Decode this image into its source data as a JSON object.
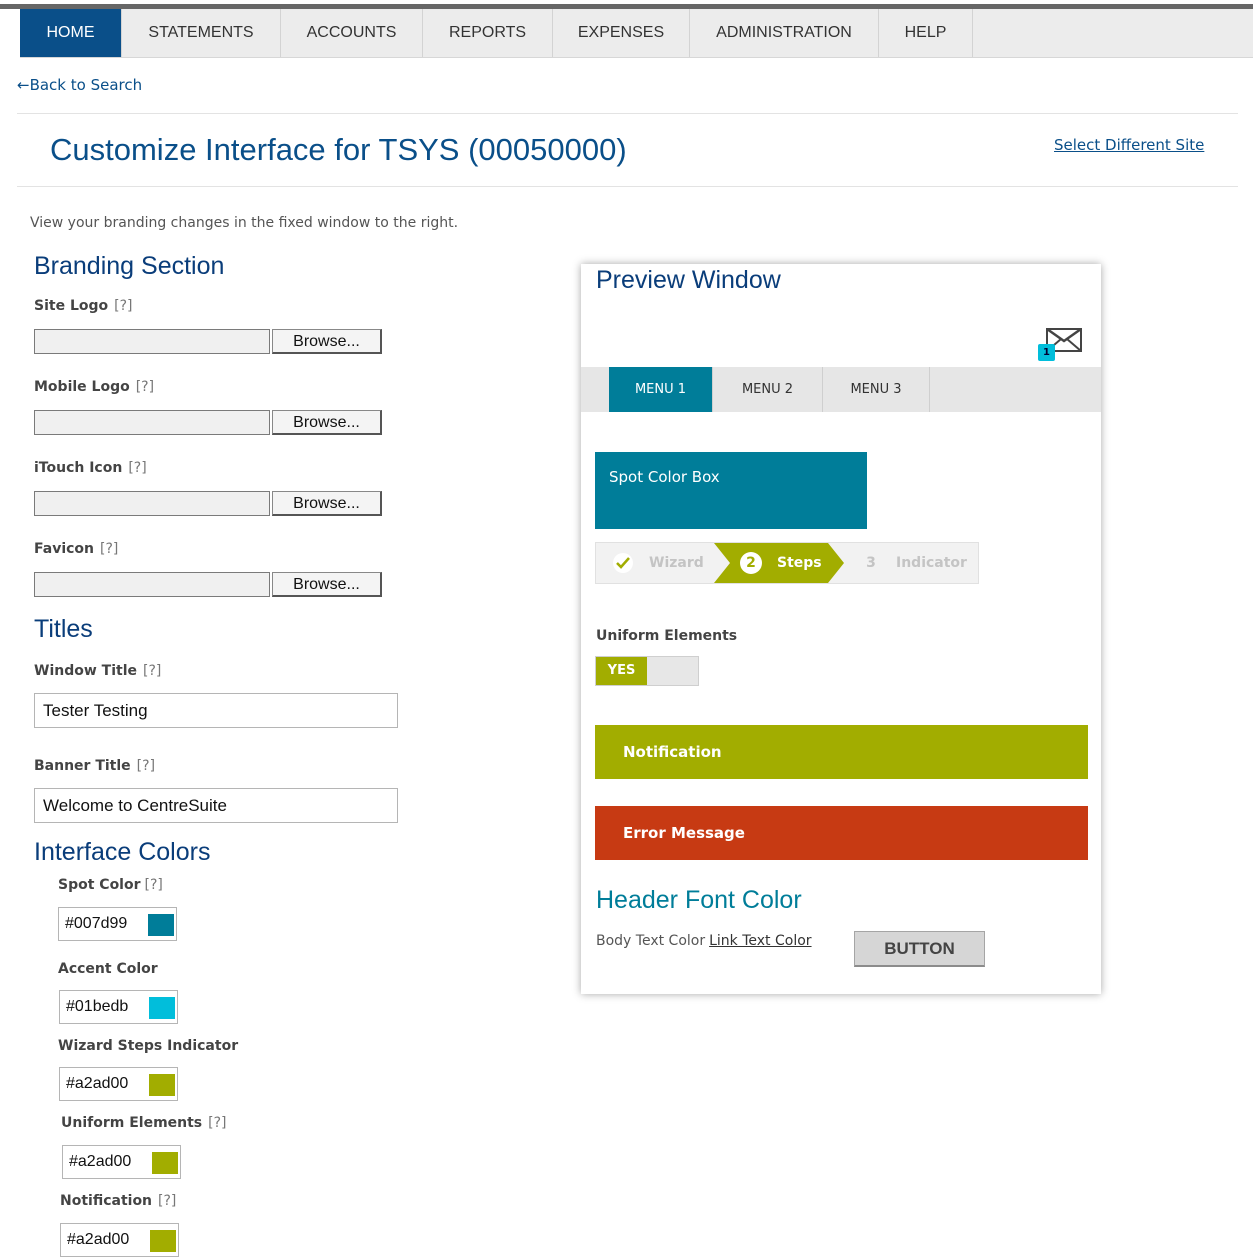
{
  "nav": {
    "tabs": [
      {
        "label": "HOME"
      },
      {
        "label": "STATEMENTS"
      },
      {
        "label": "ACCOUNTS"
      },
      {
        "label": "REPORTS"
      },
      {
        "label": "EXPENSES"
      },
      {
        "label": "ADMINISTRATION"
      },
      {
        "label": "HELP"
      }
    ],
    "active": "HOME"
  },
  "back_link": "←Back to Search",
  "page": {
    "title": "Customize Interface for TSYS (00050000)",
    "select_site": "Select Different Site",
    "intro": "View your branding changes in the fixed window to the right."
  },
  "help_marker": "[?]",
  "branding": {
    "heading": "Branding Section",
    "browse_label": "Browse...",
    "fields": [
      {
        "label": "Site Logo"
      },
      {
        "label": "Mobile Logo"
      },
      {
        "label": "iTouch Icon"
      },
      {
        "label": "Favicon"
      }
    ]
  },
  "titles": {
    "heading": "Titles",
    "window_title": {
      "label": "Window Title",
      "value": "Tester Testing"
    },
    "banner_title": {
      "label": "Banner Title",
      "value": "Welcome to CentreSuite"
    }
  },
  "colors": {
    "heading": "Interface Colors",
    "spot": {
      "label": "Spot Color",
      "value": "#007d99"
    },
    "accent": {
      "label": "Accent Color",
      "value": "#01bedb"
    },
    "wizard": {
      "label": "Wizard Steps Indicator",
      "value": "#a2ad00"
    },
    "uniform": {
      "label": "Uniform Elements",
      "value": "#a2ad00"
    },
    "notification": {
      "label": "Notification",
      "value": "#a2ad00"
    }
  },
  "preview": {
    "title": "Preview Window",
    "mail_icon": "envelope-icon",
    "mail_badge": "1",
    "menu": [
      "MENU 1",
      "MENU 2",
      "MENU 3"
    ],
    "spot_box": "Spot Color Box",
    "wizard": {
      "step1": {
        "label": "Wizard",
        "icon": "check-icon"
      },
      "step2": {
        "num": "2",
        "label": "Steps"
      },
      "step3": {
        "num": "3",
        "label": "Indicator"
      }
    },
    "uniform_label": "Uniform Elements",
    "toggle_yes": "YES",
    "notification": "Notification",
    "error": "Error Message",
    "header_font": "Header Font Color",
    "body_text": "Body Text Color",
    "link_text": "Link Text Color",
    "button": "BUTTON",
    "error_color": "#c73a13"
  }
}
